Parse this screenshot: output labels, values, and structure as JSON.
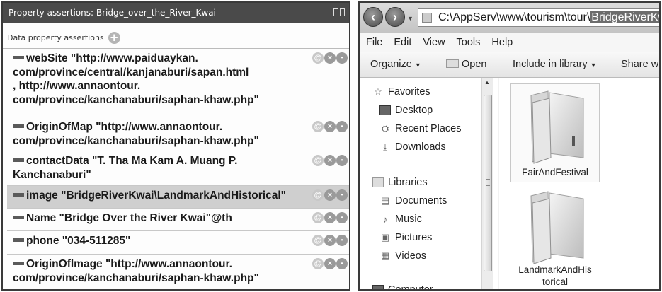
{
  "property_panel": {
    "title": "Property assertions: Bridge_over_the_River_Kwai",
    "section_label": "Data property assertions",
    "add_icon": "+",
    "rows": [
      {
        "text": "webSite  \"http://www.paiduaykan.\ncom/province/central/kanjanaburi/sapan.html\n, http://www.annaontour.\ncom/province/kanchanaburi/saphan-khaw.php\"",
        "selected": false
      },
      {
        "text": "OriginOfMap  \"http://www.annaontour.\ncom/province/kanchanaburi/saphan-khaw.php\"",
        "selected": false
      },
      {
        "text": "contactData  \"T. Tha Ma Kam A. Muang P.\nKanchanaburi\"",
        "selected": false
      },
      {
        "text": "image  \"BridgeRiverKwai\\LandmarkAndHistorical\"",
        "selected": true
      },
      {
        "text": "Name  \"Bridge Over the River Kwai\"@th",
        "selected": false
      },
      {
        "text": "phone  \"034-511285\"",
        "selected": false
      },
      {
        "text": "OriginOfImage  \"http://www.annaontour.\ncom/province/kanchanaburi/saphan-khaw.php\"",
        "selected": false
      }
    ],
    "row_icons": {
      "annotate": "@",
      "delete": "×",
      "more": "•"
    }
  },
  "explorer": {
    "address_prefix": "C:\\AppServ\\www\\tourism\\tour\\",
    "address_selected": "BridgeRiverKwai",
    "menu": [
      "File",
      "Edit",
      "View",
      "Tools",
      "Help"
    ],
    "toolbar": {
      "organize": "Organize",
      "open": "Open",
      "include_in_library": "Include in library",
      "share_with": "Share wit"
    },
    "nav": {
      "favorites": "Favorites",
      "desktop": "Desktop",
      "recent_places": "Recent Places",
      "downloads": "Downloads",
      "libraries": "Libraries",
      "documents": "Documents",
      "music": "Music",
      "pictures": "Pictures",
      "videos": "Videos",
      "computer": "Computer"
    },
    "files": [
      {
        "name": "FairAndFestival"
      },
      {
        "name": "LandmarkAndHis\ntorical"
      }
    ]
  }
}
